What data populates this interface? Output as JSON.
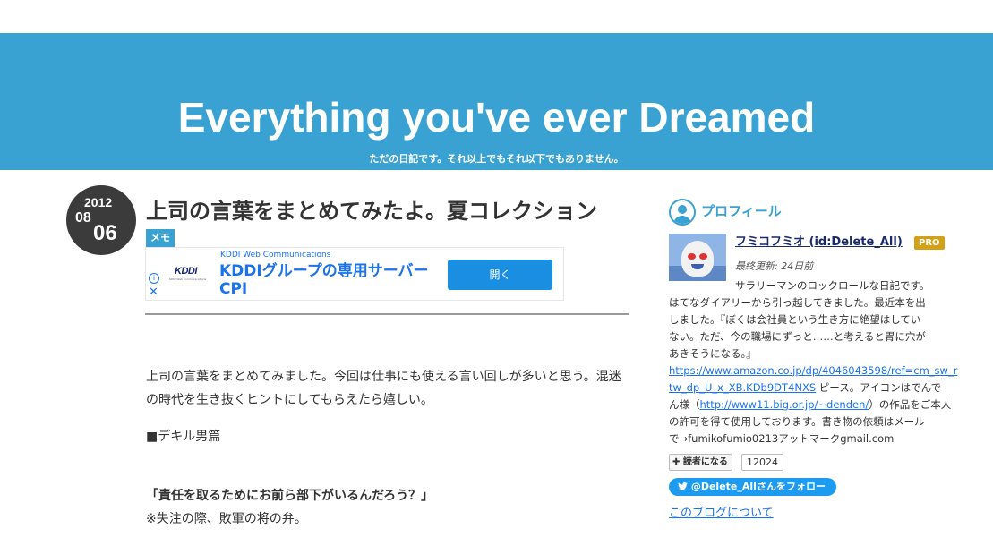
{
  "header": {
    "title": "Everything you've ever Dreamed",
    "description": "ただの日記です。それ以上でもそれ以下でもありません。"
  },
  "entry": {
    "date": {
      "year": "2012",
      "month": "08",
      "day": "06"
    },
    "title": "上司の言葉をまとめてみたよ。夏コレクション",
    "category": "メモ",
    "paragraph1": "上司の言葉をまとめてみました。今回は仕事にも使える言い回しが多いと思う。混迷の時代を生き抜くヒントにしてもらえたら嬉しい。",
    "paragraph2": "■デキル男篇",
    "quote": "「責任を取るためにお前ら部下がいるんだろう？」",
    "note": "※失注の際、敗軍の将の弁。"
  },
  "ad": {
    "logo": "KDDI",
    "logo_sub": "KDDI Web Communications",
    "sponsor": "KDDI Web Communications",
    "headline": "KDDIグループの専用サーバーCPI",
    "button": "開く",
    "info_icon": "i",
    "close_icon": "✕"
  },
  "sidebar": {
    "profile_title": "プロフィール",
    "user_name": "フミコフミオ (id:Delete_All)",
    "pro_badge": "PRO",
    "updated": "最終更新: 24日前",
    "bio": [
      "サラリーマンのロックロールな日記です。",
      "はてなダイアリーから引っ越してきました。最近本を出",
      "しました。『ぼくは会社員という生き方に絶望はしてい",
      "ない。ただ、今の職場にずっと……と考えると胃に穴が",
      "あきそうになる。』"
    ],
    "amazon_link_1": "https://www.amazon.co.jp/dp/4046043598/ref=cm_sw_r",
    "amazon_link_2": "tw_dp_U_x_XB.KDb9DT4NXS",
    "bio_after_link": " ピース。アイコンはでんで",
    "bio_line_a": "ん様（",
    "denden_link": "http://www11.big.or.jp/~denden/",
    "bio_line_b": "）の作品をご本人",
    "bio_tail": [
      "の許可を得て使用しております。書き物の依頼はメール",
      "で→fumikofumio0213アットマークgmail.com"
    ],
    "reader_button": "読者になる",
    "reader_count": "12024",
    "twitter_button": "@Delete_Allさんをフォロー",
    "about_link": "このブログについて"
  },
  "colors": {
    "accent": "#39a2d2",
    "date_bg": "#3b3b3b",
    "pro": "#d4a017",
    "twitter": "#1d9bf0"
  }
}
